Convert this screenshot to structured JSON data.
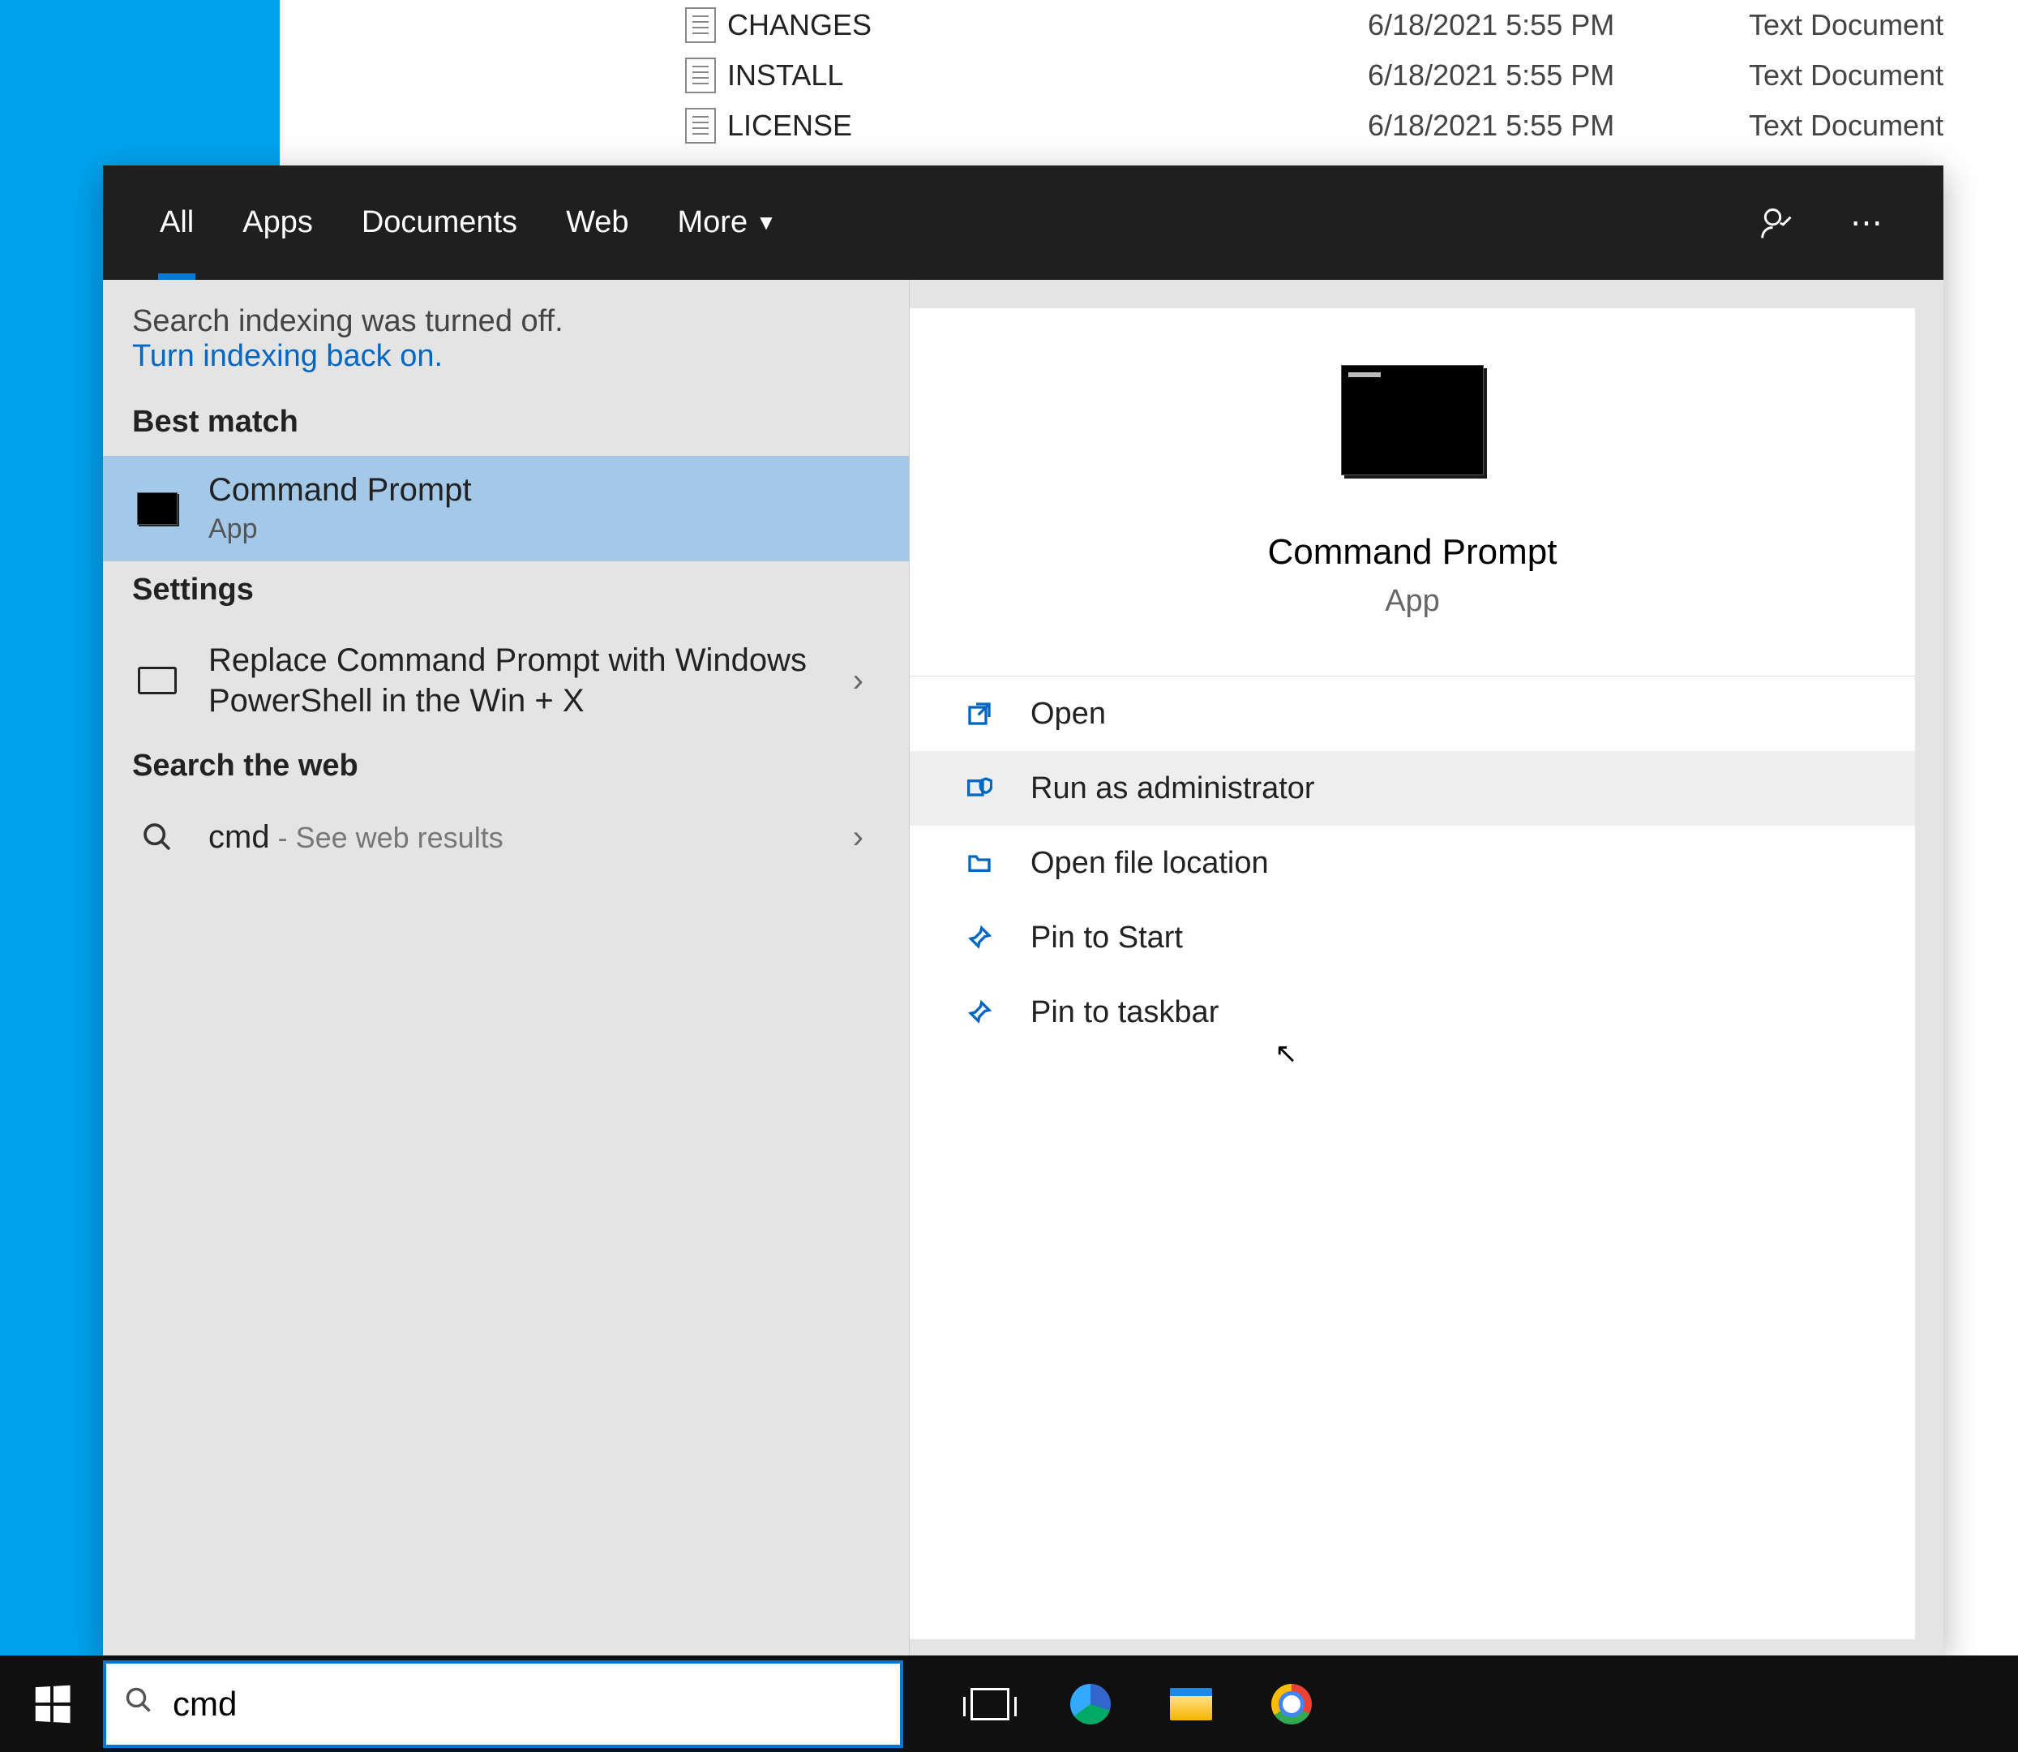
{
  "explorer": {
    "files": [
      {
        "name": "CHANGES",
        "date": "6/18/2021 5:55 PM",
        "type": "Text Document"
      },
      {
        "name": "INSTALL",
        "date": "6/18/2021 5:55 PM",
        "type": "Text Document"
      },
      {
        "name": "LICENSE",
        "date": "6/18/2021 5:55 PM",
        "type": "Text Document"
      }
    ]
  },
  "tabs": {
    "all": "All",
    "apps": "Apps",
    "documents": "Documents",
    "web": "Web",
    "more": "More"
  },
  "notice": {
    "line1": "Search indexing was turned off.",
    "link": "Turn indexing back on."
  },
  "sections": {
    "best": "Best match",
    "settings": "Settings",
    "web": "Search the web"
  },
  "best_match": {
    "title": "Command Prompt",
    "subtitle": "App"
  },
  "settings_item": {
    "title": "Replace Command Prompt with Windows PowerShell in the Win + X"
  },
  "web_item": {
    "query": "cmd",
    "suffix": " - See web results"
  },
  "preview": {
    "title": "Command Prompt",
    "subtitle": "App"
  },
  "actions": {
    "open": "Open",
    "run_admin": "Run as administrator",
    "open_loc": "Open file location",
    "pin_start": "Pin to Start",
    "pin_taskbar": "Pin to taskbar"
  },
  "search": {
    "value": "cmd"
  }
}
